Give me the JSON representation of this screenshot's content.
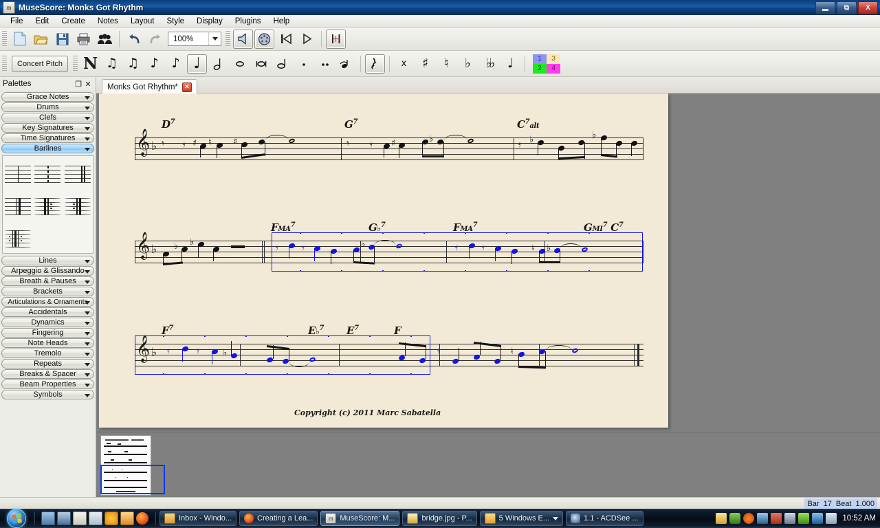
{
  "window": {
    "title": "MuseScore: Monks Got Rhythm",
    "app_icon": "musescore-icon",
    "minimize_label": "Minimize",
    "maximize_label": "Maximize",
    "close_label": "X"
  },
  "menu": [
    "File",
    "Edit",
    "Create",
    "Notes",
    "Layout",
    "Style",
    "Display",
    "Plugins",
    "Help"
  ],
  "toolbar_main": {
    "buttons": [
      {
        "name": "new-score-button",
        "icon": "new-file-icon"
      },
      {
        "name": "open-score-button",
        "icon": "open-folder-icon"
      },
      {
        "name": "save-score-button",
        "icon": "save-disk-icon"
      },
      {
        "name": "print-button",
        "icon": "printer-icon"
      },
      {
        "name": "parts-button",
        "icon": "people-icon"
      },
      {
        "name": "undo-button",
        "icon": "undo-arrow-icon"
      },
      {
        "name": "redo-button",
        "icon": "redo-arrow-icon"
      }
    ],
    "zoom_value": "100%",
    "playback": [
      {
        "name": "play-panel-button",
        "icon": "speaker-icon",
        "pressed": true
      },
      {
        "name": "midi-input-button",
        "icon": "midi-port-icon",
        "pressed": true
      },
      {
        "name": "rewind-button",
        "icon": "rewind-icon",
        "pressed": false
      },
      {
        "name": "play-button",
        "icon": "play-triangle-icon",
        "pressed": false
      },
      {
        "name": "metronome-button",
        "icon": "metronome-icon",
        "pressed": true
      }
    ]
  },
  "toolbar_note": {
    "concert_pitch_label": "Concert Pitch",
    "note_input_label": "N",
    "durations": [
      {
        "name": "duration-64th",
        "glyph": "♫"
      },
      {
        "name": "duration-32nd",
        "glyph": "♫"
      },
      {
        "name": "duration-16th",
        "glyph": "♪"
      },
      {
        "name": "duration-eighth",
        "glyph": "♪"
      },
      {
        "name": "duration-quarter",
        "glyph": "♩",
        "selected": true
      },
      {
        "name": "duration-half",
        "glyph": "ᴕE"
      },
      {
        "name": "duration-whole",
        "glyph": "ᴕD"
      },
      {
        "name": "duration-breve",
        "glyph": "ᴕC"
      },
      {
        "name": "duration-longa",
        "glyph": "ᴕB"
      },
      {
        "name": "duration-dot",
        "glyph": "."
      },
      {
        "name": "duration-double-dot",
        "glyph": ".."
      },
      {
        "name": "tie-button",
        "glyph": "⁀"
      }
    ],
    "rest_label": "rest",
    "accidentals": [
      {
        "name": "accidental-double-sharp",
        "glyph": "×"
      },
      {
        "name": "accidental-sharp",
        "glyph": "♯"
      },
      {
        "name": "accidental-natural",
        "glyph": "♮"
      },
      {
        "name": "accidental-flat",
        "glyph": "♭"
      },
      {
        "name": "accidental-double-flat",
        "glyph": "♭♭"
      },
      {
        "name": "flip-direction",
        "glyph": "♩"
      }
    ],
    "voices": [
      {
        "label": "1",
        "color": "#8c94ee",
        "text": "#1515cc"
      },
      {
        "label": "3",
        "color": "#fbe6b4",
        "text": "#7a6520"
      },
      {
        "label": "2",
        "color": "#1ee81e",
        "text": "#0a5a0a"
      },
      {
        "label": "4",
        "color": "#ff3df0",
        "text": "#6a0a63"
      }
    ]
  },
  "palettes": {
    "title": "Palettes",
    "undock_label": "❐",
    "close_label": "✕",
    "items_top": [
      "Grace Notes",
      "Drums",
      "Clefs",
      "Key Signatures",
      "Time Signatures"
    ],
    "active_item": "Barlines",
    "barline_cells": [
      "normal-barline",
      "dashed-barline",
      "double-barline",
      "end-barline",
      "start-repeat-barline",
      "end-repeat-barline",
      "end-start-repeat-barline"
    ],
    "items_bottom": [
      "Lines",
      "Arpeggio & Glissando",
      "Breath & Pauses",
      "Brackets",
      "Articulations & Ornaments",
      "Accidentals",
      "Dynamics",
      "Fingering",
      "Note Heads",
      "Tremolo",
      "Repeats",
      "Breaks & Spacer",
      "Beam Properties",
      "Symbols"
    ]
  },
  "score": {
    "tab_label": "Monks Got Rhythm*",
    "tab_close": "✕",
    "copyright": "Copyright (c) 2011 Marc Sabatella",
    "key_signature": "one-flat",
    "clef": "treble",
    "systems": [
      {
        "chords": [
          "D7",
          "G7",
          "C7alt"
        ]
      },
      {
        "chords": [
          "FMA7",
          "Gb7",
          "FMA7",
          "GMI7 C7"
        ]
      },
      {
        "chords": [
          "F7",
          "Eb7",
          "E7",
          "F"
        ]
      }
    ],
    "selection_color": "#1414e6",
    "selection_note": "voice-1 selected range, systems 2 and 3"
  },
  "statusbar": {
    "bar_label": "Bar",
    "bar_value": "17",
    "beat_label": "Beat",
    "beat_value": "1.000"
  },
  "taskbar": {
    "start_label": "Start",
    "quick_launch": [
      "show-desktop-icon",
      "switch-window-icon",
      "notepad-icon",
      "window-icon",
      "media-player-icon",
      "internet-icon",
      "firefox-icon"
    ],
    "buttons": [
      {
        "label": "Inbox - Windo...",
        "icon": "mail-icon",
        "active": false
      },
      {
        "label": "Creating a Lea...",
        "icon": "firefox-icon",
        "active": false
      },
      {
        "label": "MuseScore: M...",
        "icon": "musescore-icon",
        "active": true
      },
      {
        "label": "bridge.jpg - P...",
        "icon": "paint-icon",
        "active": false
      },
      {
        "label": "5 Windows E...",
        "icon": "folder-icon",
        "active": false,
        "has_arrow": true
      },
      {
        "label": "1.1 - ACDSee ...",
        "icon": "acdsee-icon",
        "active": false
      }
    ],
    "tray": [
      "mail-tray-icon",
      "dropbox-icon",
      "update-icon",
      "network-tray-icon",
      "volume-mute-icon",
      "user-icon"
    ],
    "tray2": [
      "battery-icon",
      "network-icon",
      "volume-icon"
    ],
    "clock": "10:52 AM"
  }
}
